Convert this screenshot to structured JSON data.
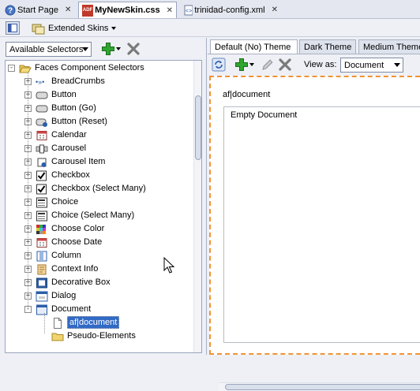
{
  "editor_tabs": [
    {
      "label": "Start Page"
    },
    {
      "label": "MyNewSkin.css",
      "icon_text": "ADF"
    },
    {
      "label": "trinidad-config.xml"
    }
  ],
  "toolbar": {
    "skins_label": "Extended Skins"
  },
  "selector_panel": {
    "filter_value": "Available Selectors",
    "tree": [
      {
        "label": "Faces Component Selectors",
        "icon": "folder-open-icon"
      },
      {
        "label": "BreadCrumbs",
        "icon": "breadcrumbs-icon"
      },
      {
        "label": "Button",
        "icon": "button-icon"
      },
      {
        "label": "Button (Go)",
        "icon": "button-icon"
      },
      {
        "label": "Button (Reset)",
        "icon": "reset-button-icon"
      },
      {
        "label": "Calendar",
        "icon": "calendar-icon"
      },
      {
        "label": "Carousel",
        "icon": "carousel-icon"
      },
      {
        "label": "Carousel Item",
        "icon": "carousel-item-icon"
      },
      {
        "label": "Checkbox",
        "icon": "checkbox-icon"
      },
      {
        "label": "Checkbox (Select Many)",
        "icon": "checkbox-icon"
      },
      {
        "label": "Choice",
        "icon": "choice-icon"
      },
      {
        "label": "Choice (Select Many)",
        "icon": "choice-icon"
      },
      {
        "label": "Choose Color",
        "icon": "color-grid-icon"
      },
      {
        "label": "Choose Date",
        "icon": "calendar-icon"
      },
      {
        "label": "Column",
        "icon": "column-icon"
      },
      {
        "label": "Context Info",
        "icon": "context-info-icon"
      },
      {
        "label": "Decorative Box",
        "icon": "decorative-box-icon"
      },
      {
        "label": "Dialog",
        "icon": "dialog-icon"
      },
      {
        "label": "Document",
        "icon": "document-icon"
      },
      {
        "label": "af|document",
        "icon": "file-icon"
      },
      {
        "label": "Pseudo-Elements",
        "icon": "folder-icon"
      }
    ]
  },
  "theme_tabs": [
    {
      "label": "Default (No) Theme"
    },
    {
      "label": "Dark Theme"
    },
    {
      "label": "Medium Theme"
    }
  ],
  "preview": {
    "view_as_label": "View as:",
    "view_as_value": "Document",
    "selector_label": "af|document",
    "body_text": "Empty Document"
  },
  "colors": {
    "accent": "#f19333",
    "selection": "#316ac5",
    "add": "#2fa52f"
  }
}
